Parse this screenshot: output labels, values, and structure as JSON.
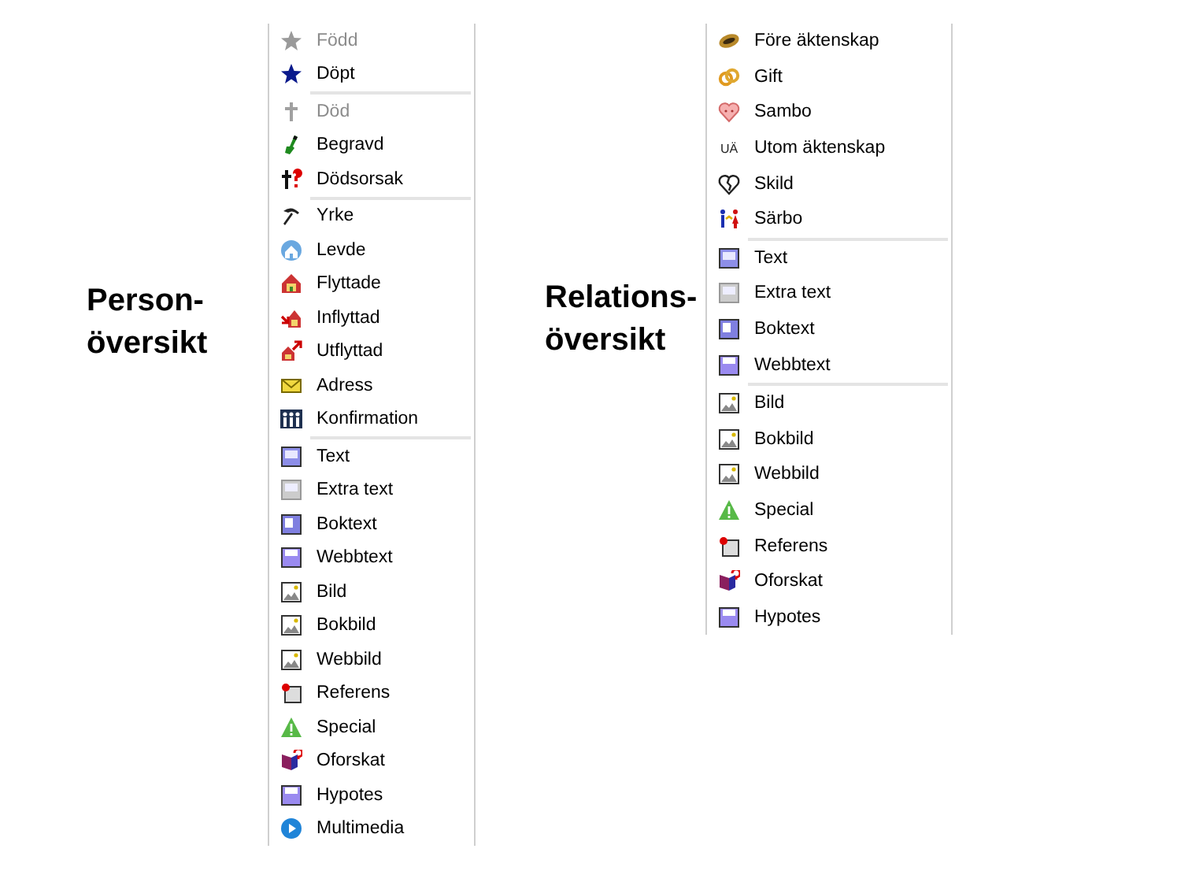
{
  "person": {
    "heading": "Person-\növersikt",
    "groups": [
      [
        {
          "label": "Född",
          "kind": "star",
          "disabled": true
        },
        {
          "label": "Döpt",
          "kind": "star",
          "disabled": false
        }
      ],
      [
        {
          "label": "Död",
          "kind": "cross",
          "disabled": true
        },
        {
          "label": "Begravd",
          "kind": "shovel",
          "disabled": false
        },
        {
          "label": "Dödsorsak",
          "kind": "cross-question",
          "disabled": false
        }
      ],
      [
        {
          "label": "Yrke",
          "kind": "pickaxe",
          "disabled": false
        },
        {
          "label": "Levde",
          "kind": "house-globe",
          "disabled": false
        },
        {
          "label": "Flyttade",
          "kind": "house-move",
          "disabled": false
        },
        {
          "label": "Inflyttad",
          "kind": "house-in",
          "disabled": false
        },
        {
          "label": "Utflyttad",
          "kind": "house-out",
          "disabled": false
        },
        {
          "label": "Adress",
          "kind": "envelope",
          "disabled": false
        },
        {
          "label": "Konfirmation",
          "kind": "people",
          "disabled": false
        }
      ],
      [
        {
          "label": "Text",
          "kind": "text-page",
          "disabled": false
        },
        {
          "label": "Extra text",
          "kind": "extra-page",
          "disabled": false
        },
        {
          "label": "Boktext",
          "kind": "book-page",
          "disabled": false
        },
        {
          "label": "Webbtext",
          "kind": "web-page",
          "disabled": false
        },
        {
          "label": "Bild",
          "kind": "image",
          "disabled": false
        },
        {
          "label": "Bokbild",
          "kind": "image",
          "disabled": false
        },
        {
          "label": "Webbild",
          "kind": "image",
          "disabled": false
        },
        {
          "label": "Referens",
          "kind": "reference",
          "disabled": false
        },
        {
          "label": "Special",
          "kind": "warning",
          "disabled": false
        },
        {
          "label": "Oforskat",
          "kind": "unknown",
          "disabled": false
        },
        {
          "label": "Hypotes",
          "kind": "web-page",
          "disabled": false
        },
        {
          "label": "Multimedia",
          "kind": "play",
          "disabled": false
        }
      ]
    ]
  },
  "relation": {
    "heading": "Relations-\növersikt",
    "groups": [
      [
        {
          "label": "Före äktenskap",
          "kind": "ring",
          "disabled": false
        },
        {
          "label": "Gift",
          "kind": "rings",
          "disabled": false
        },
        {
          "label": "Sambo",
          "kind": "heart-face",
          "disabled": false
        },
        {
          "label": "Utom äktenskap",
          "kind": "glyph",
          "icon_text": "UÄ",
          "disabled": false
        },
        {
          "label": "Skild",
          "kind": "broken-heart",
          "disabled": false
        },
        {
          "label": "Särbo",
          "kind": "couple",
          "disabled": false
        }
      ],
      [
        {
          "label": "Text",
          "kind": "text-page",
          "disabled": false
        },
        {
          "label": "Extra text",
          "kind": "extra-page",
          "disabled": false
        },
        {
          "label": "Boktext",
          "kind": "book-page",
          "disabled": false
        },
        {
          "label": "Webbtext",
          "kind": "web-page",
          "disabled": false
        }
      ],
      [
        {
          "label": "Bild",
          "kind": "image",
          "disabled": false
        },
        {
          "label": "Bokbild",
          "kind": "image",
          "disabled": false
        },
        {
          "label": "Webbild",
          "kind": "image",
          "disabled": false
        },
        {
          "label": "Special",
          "kind": "warning",
          "disabled": false
        },
        {
          "label": "Referens",
          "kind": "reference",
          "disabled": false
        },
        {
          "label": "Oforskat",
          "kind": "unknown",
          "disabled": false
        },
        {
          "label": "Hypotes",
          "kind": "web-page",
          "disabled": false
        }
      ]
    ]
  }
}
